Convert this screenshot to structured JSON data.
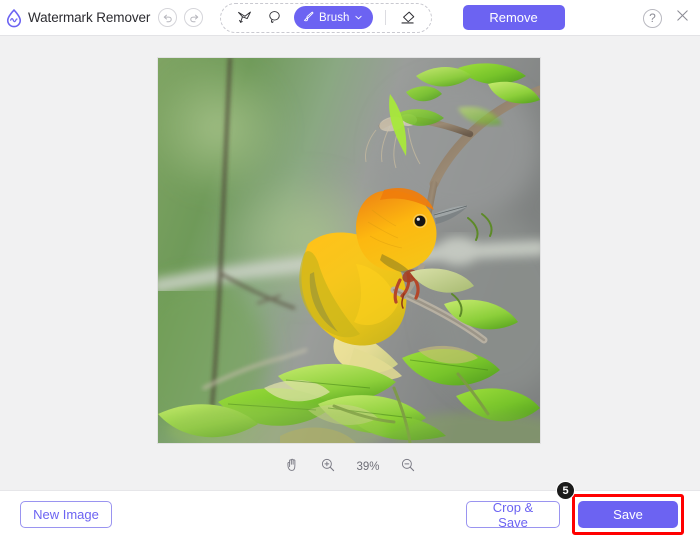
{
  "app": {
    "title": "Watermark Remover",
    "logo_icon": "water-drop-wave-icon",
    "accent_color": "#6c63f2",
    "highlight_color": "#ff0000",
    "badge_color": "#1b1b1b"
  },
  "toolbar": {
    "undo_icon": "undo-arrow-icon",
    "redo_icon": "redo-arrow-icon",
    "tools": [
      {
        "name": "polygonal-lasso",
        "icon": "polygonal-lasso-icon"
      },
      {
        "name": "freehand-lasso",
        "icon": "freehand-lasso-icon"
      }
    ],
    "brush": {
      "label": "Brush",
      "icon": "paintbrush-icon",
      "chevron_icon": "chevron-down-icon"
    },
    "eraser": {
      "name": "eraser",
      "icon": "eraser-icon"
    },
    "remove_label": "Remove",
    "help_label": "?",
    "help_icon": "question-mark-icon",
    "close_icon": "close-x-icon"
  },
  "canvas": {
    "image_alt": "Yellow weaver bird perched on a branch with green leaves",
    "zoom": {
      "hand_icon": "hand-pan-icon",
      "zoom_in_icon": "zoom-in-icon",
      "zoom_out_icon": "zoom-out-icon",
      "level": "39%"
    }
  },
  "footer": {
    "new_image_label": "New Image",
    "crop_save_label": "Crop & Save",
    "save_label": "Save",
    "step_badge": "5"
  }
}
